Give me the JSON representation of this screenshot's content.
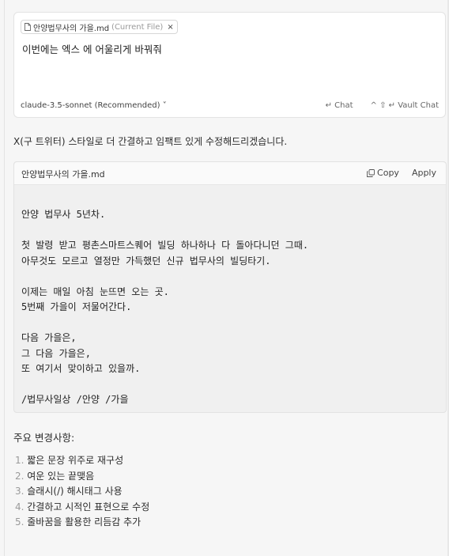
{
  "composer": {
    "file_chip": {
      "name": "안양법무사의 가을.md",
      "tag": "(Current File)",
      "close": "×"
    },
    "message": "이번에는 엑스 에 어울리게 바꿔줘",
    "model": "claude-3.5-sonnet (Recommended)",
    "model_chevron": "˅",
    "chat_label": "↵ Chat",
    "vault_chat_label": "^ ⇧ ↵ Vault Chat"
  },
  "assistant": {
    "intro": "X(구 트위터) 스타일로 더 간결하고 임팩트 있게 수정해드리겠습니다.",
    "code_block": {
      "filename": "안양법무사의 가을.md",
      "copy_label": "Copy",
      "apply_label": "Apply",
      "lines": [
        "안양 법무사 5년차.",
        "",
        "첫 발령 받고 평촌스마트스퀘어 빌딩 하나하나 다 돌아다니던 그때.",
        "아무것도 모르고 열정만 가득했던 신규 법무사의 빌딩타기.",
        "",
        "이제는 매일 아침 눈뜨면 오는 곳.",
        "5번째 가을이 저물어간다.",
        "",
        "다음 가을은,",
        "그 다음 가을은,",
        "또 여기서 맞이하고 있을까.",
        "",
        "/법무사일상 /안양 /가을"
      ]
    },
    "changes_title": "주요 변경사항:",
    "changes": [
      {
        "num": "1.",
        "text": "짧은 문장 위주로 재구성"
      },
      {
        "num": "2.",
        "text": "여운 있는 끝맺음"
      },
      {
        "num": "3.",
        "text": "슬래시(/) 해시태그 사용"
      },
      {
        "num": "4.",
        "text": "간결하고 시적인 표현으로 수정"
      },
      {
        "num": "5.",
        "text": "줄바꿈을 활용한 리듬감 추가"
      }
    ]
  }
}
